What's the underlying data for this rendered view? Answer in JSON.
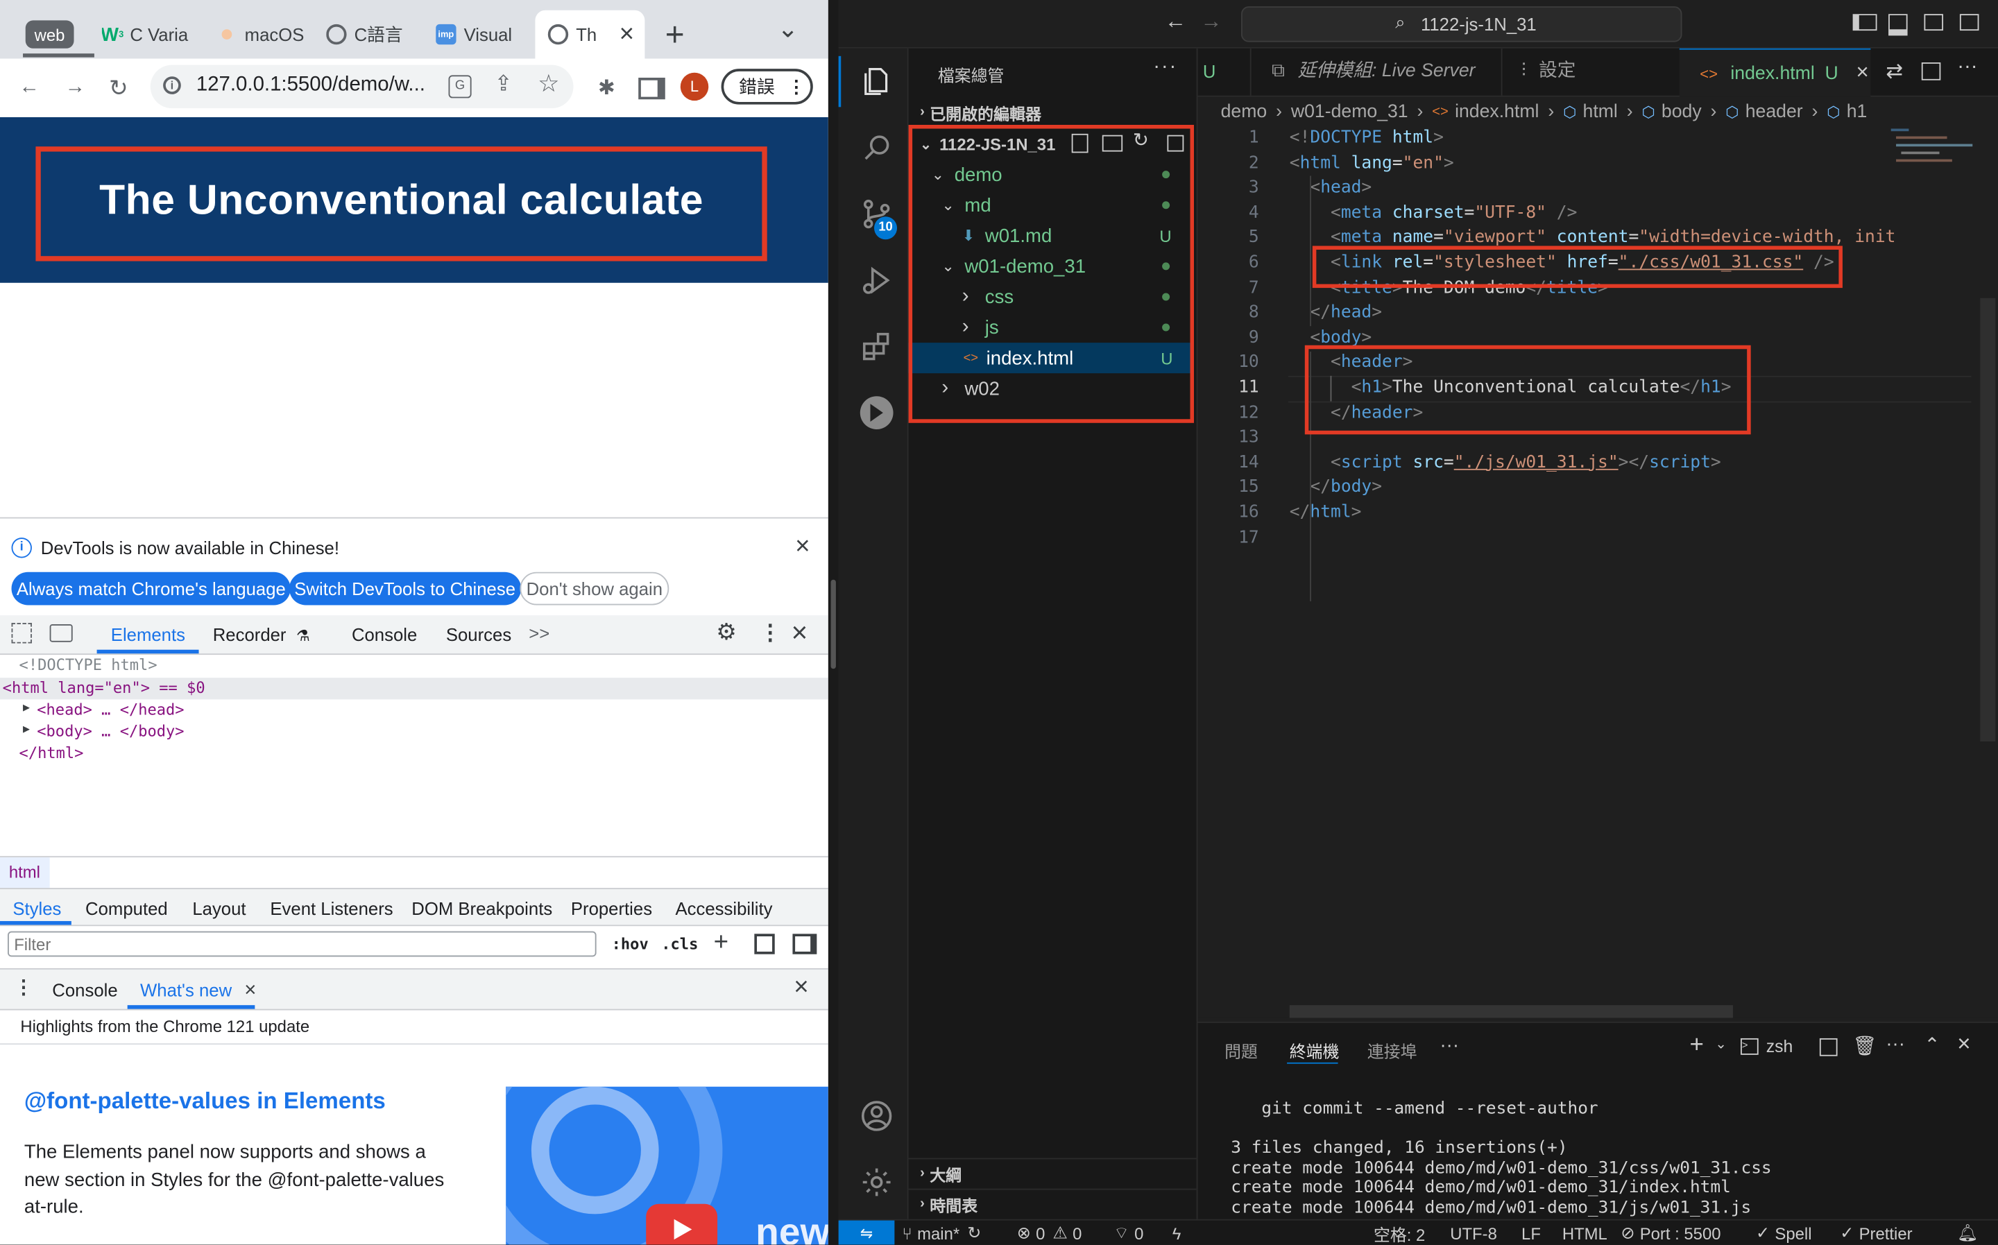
{
  "chrome": {
    "tabs": [
      {
        "label": "web",
        "type": "group"
      },
      {
        "label": "C Varia",
        "icon": "w3-icon"
      },
      {
        "label": "macOS",
        "icon": "macos-icon"
      },
      {
        "label": "C語言",
        "icon": "globe-icon"
      },
      {
        "label": "Visual",
        "icon": "visual-icon"
      },
      {
        "label": "Th",
        "icon": "globe-icon",
        "active": true
      }
    ],
    "close_glyph": "×",
    "new_tab_glyph": "+",
    "dropdown_glyph": "⌄",
    "url": "127.0.0.1:5500/demo/w...",
    "profile_initial": "L",
    "error_label": "錯誤",
    "page": {
      "header_bg": "#0d3a6e",
      "title": "The Unconventional calculate"
    },
    "devtools": {
      "banner": "DevTools is now available in Chinese!",
      "btn_match": "Always match Chrome's language",
      "btn_switch": "Switch DevTools to Chinese",
      "btn_dont": "Don't show again",
      "tabs": [
        "Elements",
        "Recorder",
        "Console",
        "Sources"
      ],
      "more_glyph": ">>",
      "dom_lines": [
        "<!DOCTYPE html>",
        "<html lang=\"en\"> == $0",
        "<head> … </head>",
        "<body> … </body>",
        "</html>"
      ],
      "crumb": "html",
      "style_tabs": [
        "Styles",
        "Computed",
        "Layout",
        "Event Listeners",
        "DOM Breakpoints",
        "Properties",
        "Accessibility"
      ],
      "filter_placeholder": "Filter",
      "hov": ":hov",
      "cls": ".cls",
      "drawer_tabs": [
        "Console",
        "What's new"
      ],
      "whatsnew_sub": "Highlights from the Chrome 121 update",
      "feature_title": "@font-palette-values in Elements",
      "feature_body": "The Elements panel now supports and shows a new section in Styles for the @font-palette-values at-rule.",
      "video_text": "new"
    }
  },
  "vscode": {
    "search_text": "1122-js-1N_31",
    "explorer_title": "檔案總管",
    "open_editors": "已開啟的編輯器",
    "root_folder": "1122-JS-1N_31",
    "tree": [
      {
        "label": "demo",
        "depth": 1,
        "kind": "folder-open",
        "status": "dot"
      },
      {
        "label": "md",
        "depth": 2,
        "kind": "folder-open",
        "status": "dot"
      },
      {
        "label": "w01.md",
        "depth": 3,
        "kind": "md",
        "status": "U"
      },
      {
        "label": "w01-demo_31",
        "depth": 2,
        "kind": "folder-open",
        "status": "dot"
      },
      {
        "label": "css",
        "depth": 3,
        "kind": "folder",
        "status": "dot"
      },
      {
        "label": "js",
        "depth": 3,
        "kind": "folder",
        "status": "dot"
      },
      {
        "label": "index.html",
        "depth": 3,
        "kind": "html",
        "status": "U",
        "selected": true
      },
      {
        "label": "w02",
        "depth": 2,
        "kind": "folder",
        "status": ""
      }
    ],
    "outline": "大綱",
    "timeline": "時間表",
    "scm_badge": "10",
    "editor_tabs": [
      {
        "label": "U",
        "type": "fragment"
      },
      {
        "label": "延伸模組: Live Server",
        "italic": true
      },
      {
        "label": "設定"
      },
      {
        "label": "index.html",
        "status": "U",
        "active": true
      }
    ],
    "breadcrumbs": [
      "demo",
      "w01-demo_31",
      "index.html",
      "html",
      "body",
      "header",
      "h1"
    ],
    "code": [
      [
        [
          "t-punc",
          "<!"
        ],
        [
          "t-tag",
          "DOCTYPE"
        ],
        [
          "t-txt",
          " "
        ],
        [
          "t-attr",
          "html"
        ],
        [
          "t-punc",
          ">"
        ]
      ],
      [
        [
          "t-punc",
          "<"
        ],
        [
          "t-tag",
          "html"
        ],
        [
          "t-txt",
          " "
        ],
        [
          "t-attr",
          "lang"
        ],
        [
          "t-txt",
          "="
        ],
        [
          "t-str",
          "\"en\""
        ],
        [
          "t-punc",
          ">"
        ]
      ],
      [
        [
          "t-txt",
          "  "
        ],
        [
          "t-punc",
          "<"
        ],
        [
          "t-tag",
          "head"
        ],
        [
          "t-punc",
          ">"
        ]
      ],
      [
        [
          "t-txt",
          "    "
        ],
        [
          "t-punc",
          "<"
        ],
        [
          "t-tag",
          "meta"
        ],
        [
          "t-txt",
          " "
        ],
        [
          "t-attr",
          "charset"
        ],
        [
          "t-txt",
          "="
        ],
        [
          "t-str",
          "\"UTF-8\""
        ],
        [
          "t-txt",
          " "
        ],
        [
          "t-punc",
          "/>"
        ]
      ],
      [
        [
          "t-txt",
          "    "
        ],
        [
          "t-punc",
          "<"
        ],
        [
          "t-tag",
          "meta"
        ],
        [
          "t-txt",
          " "
        ],
        [
          "t-attr",
          "name"
        ],
        [
          "t-txt",
          "="
        ],
        [
          "t-str",
          "\"viewport\""
        ],
        [
          "t-txt",
          " "
        ],
        [
          "t-attr",
          "content"
        ],
        [
          "t-txt",
          "="
        ],
        [
          "t-str",
          "\"width=device-width, init"
        ]
      ],
      [
        [
          "t-txt",
          "    "
        ],
        [
          "t-punc",
          "<"
        ],
        [
          "t-tag",
          "link"
        ],
        [
          "t-txt",
          " "
        ],
        [
          "t-attr",
          "rel"
        ],
        [
          "t-txt",
          "="
        ],
        [
          "t-str",
          "\"stylesheet\""
        ],
        [
          "t-txt",
          " "
        ],
        [
          "t-attr",
          "href"
        ],
        [
          "t-txt",
          "="
        ],
        [
          "t-str",
          "\"./css/w01_31.css\""
        ],
        [
          "t-txt",
          " "
        ],
        [
          "t-punc",
          "/>"
        ]
      ],
      [
        [
          "t-txt",
          "    "
        ],
        [
          "t-punc",
          "<"
        ],
        [
          "t-tag",
          "title"
        ],
        [
          "t-punc",
          ">"
        ],
        [
          "t-txt",
          "The DOM demo"
        ],
        [
          "t-punc",
          "</"
        ],
        [
          "t-tag",
          "title"
        ],
        [
          "t-punc",
          ">"
        ]
      ],
      [
        [
          "t-txt",
          "  "
        ],
        [
          "t-punc",
          "</"
        ],
        [
          "t-tag",
          "head"
        ],
        [
          "t-punc",
          ">"
        ]
      ],
      [
        [
          "t-txt",
          "  "
        ],
        [
          "t-punc",
          "<"
        ],
        [
          "t-tag",
          "body"
        ],
        [
          "t-punc",
          ">"
        ]
      ],
      [
        [
          "t-txt",
          "    "
        ],
        [
          "t-punc",
          "<"
        ],
        [
          "t-tag",
          "header"
        ],
        [
          "t-punc",
          ">"
        ]
      ],
      [
        [
          "t-txt",
          "      "
        ],
        [
          "t-punc",
          "<"
        ],
        [
          "t-tag",
          "h1"
        ],
        [
          "t-punc",
          ">"
        ],
        [
          "t-txt",
          "The Unconventional calculate"
        ],
        [
          "t-punc",
          "</"
        ],
        [
          "t-tag",
          "h1"
        ],
        [
          "t-punc",
          ">"
        ]
      ],
      [
        [
          "t-txt",
          "    "
        ],
        [
          "t-punc",
          "</"
        ],
        [
          "t-tag",
          "header"
        ],
        [
          "t-punc",
          ">"
        ]
      ],
      [
        [
          "t-txt",
          ""
        ]
      ],
      [
        [
          "t-txt",
          "    "
        ],
        [
          "t-punc",
          "<"
        ],
        [
          "t-tag",
          "script"
        ],
        [
          "t-txt",
          " "
        ],
        [
          "t-attr",
          "src"
        ],
        [
          "t-txt",
          "="
        ],
        [
          "t-str",
          "\"./js/w01_31.js\""
        ],
        [
          "t-punc",
          "></"
        ],
        [
          "t-tag",
          "script"
        ],
        [
          "t-punc",
          ">"
        ]
      ],
      [
        [
          "t-txt",
          "  "
        ],
        [
          "t-punc",
          "</"
        ],
        [
          "t-tag",
          "body"
        ],
        [
          "t-punc",
          ">"
        ]
      ],
      [
        [
          "t-punc",
          "</"
        ],
        [
          "t-tag",
          "html"
        ],
        [
          "t-punc",
          ">"
        ]
      ],
      [
        [
          "t-txt",
          ""
        ]
      ]
    ],
    "line_numbers": [
      "1",
      "2",
      "3",
      "4",
      "5",
      "6",
      "7",
      "8",
      "9",
      "10",
      "11",
      "12",
      "13",
      "14",
      "15",
      "16",
      "17"
    ],
    "current_line": "11",
    "panel_tabs": [
      "問題",
      "終端機",
      "連接埠"
    ],
    "panel_more": "···",
    "shell": "zsh",
    "terminal": [
      "    git commit --amend --reset-author",
      "",
      " 3 files changed, 16 insertions(+)",
      " create mode 100644 demo/md/w01-demo_31/css/w01_31.css",
      " create mode 100644 demo/md/w01-demo_31/index.html",
      " create mode 100644 demo/md/w01-demo_31/js/w01_31.js"
    ],
    "statusbar": {
      "branch": "main*",
      "errors": "0",
      "warnings": "0",
      "ports": "0",
      "spaces": "空格: 2",
      "encoding": "UTF-8",
      "eol": "LF",
      "lang": "HTML",
      "port": "Port : 5500",
      "spell": "Spell",
      "prettier": "Prettier"
    }
  }
}
